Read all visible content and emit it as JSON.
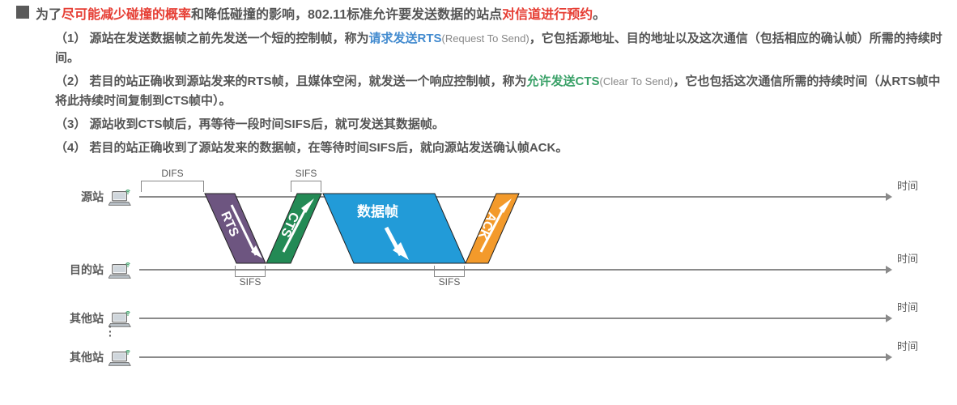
{
  "title": {
    "t1": "为了",
    "t2": "尽可能减少碰撞的概率",
    "t3": "和降低碰撞的影响，802.11标准允许要发送数据的站点",
    "t4": "对信道进行预约",
    "t5": "。"
  },
  "items": [
    {
      "num": "（1）",
      "p1": "源站在发送数据帧之前先发送一个短的控制帧，称为",
      "hl": "请求发送RTS",
      "hlClass": "blue",
      "sub": "(Request To Send)",
      "p2": "，它包括源地址、目的地址以及这次通信（包括相应的确认帧）所需的持续时间。"
    },
    {
      "num": "（2）",
      "p1": "若目的站正确收到源站发来的RTS帧，且媒体空闲，就发送一个响应控制帧，称为",
      "hl": "允许发送CTS",
      "hlClass": "green",
      "sub": "(Clear To Send)",
      "p2": "，它也包括这次通信所需的持续时间（从RTS帧中将此持续时间复制到CTS帧中）。"
    },
    {
      "num": "（3）",
      "p1": "源站收到CTS帧后，再等待一段时间SIFS后，就可发送其数据帧。",
      "hl": "",
      "hlClass": "",
      "sub": "",
      "p2": ""
    },
    {
      "num": "（4）",
      "p1": "若目的站正确收到了源站发来的数据帧，在等待时间SIFS后，就向源站发送确认帧ACK。",
      "hl": "",
      "hlClass": "",
      "sub": "",
      "p2": ""
    }
  ],
  "diagram": {
    "rows": [
      "源站",
      "目的站",
      "其他站",
      "其他站"
    ],
    "timeLabel": "时间",
    "labels": {
      "difs": "DIFS",
      "sifs": "SIFS"
    },
    "frames": {
      "rts": "RTS",
      "cts": "CTS",
      "data": "数据帧",
      "ack": "ACK"
    }
  }
}
